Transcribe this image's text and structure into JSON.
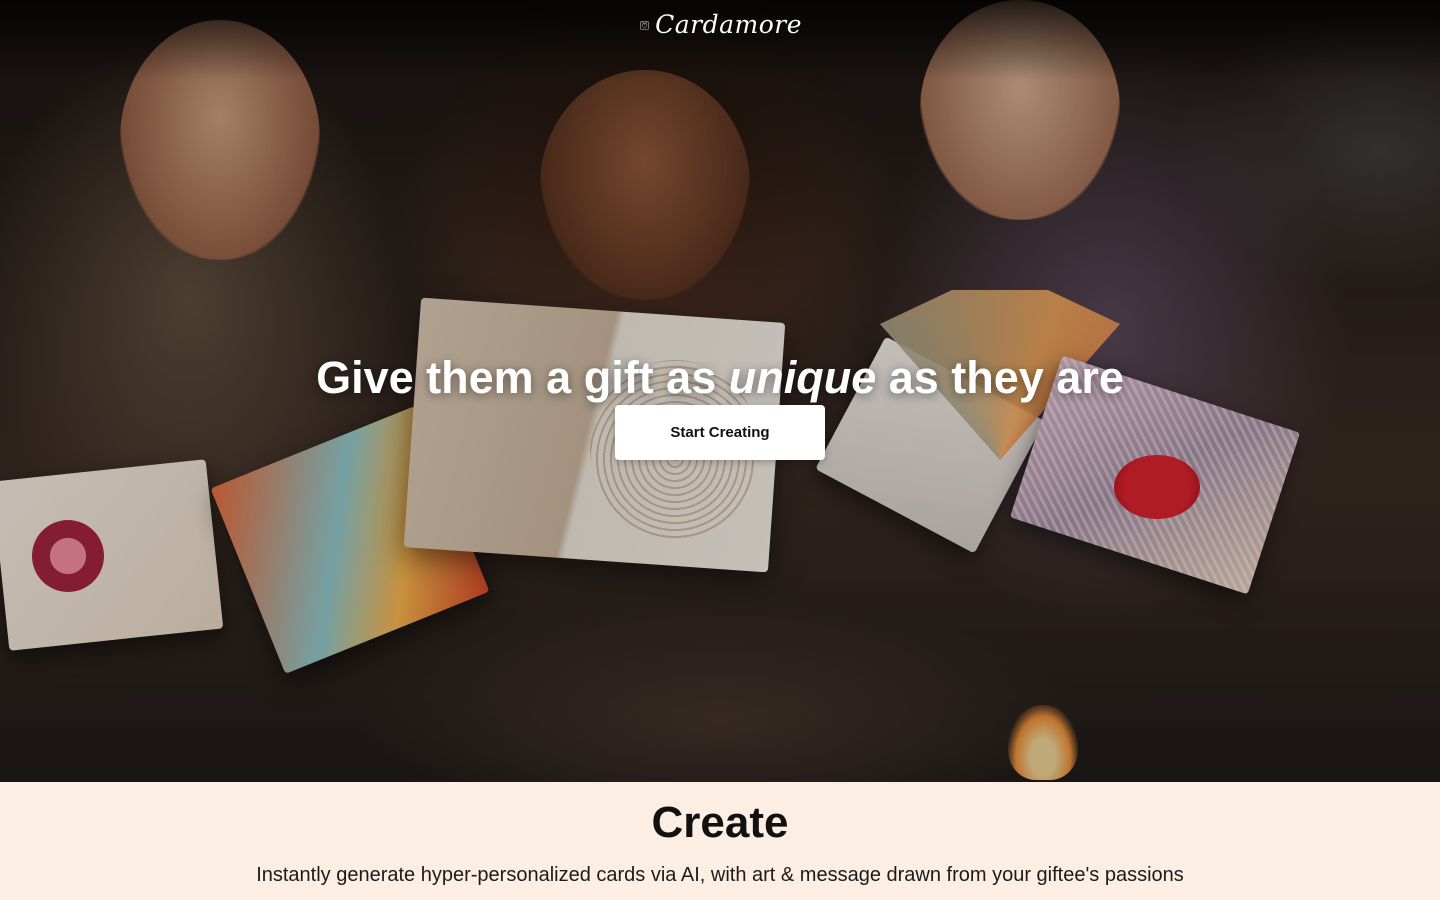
{
  "brand": {
    "name": "Cardamore",
    "logo_icon": "heart-card-icon"
  },
  "hero": {
    "image_alt": "friends-opening-greeting-cards-photo",
    "headline_before": "Give them a gift as ",
    "headline_emphasis": "unique",
    "headline_after": " as they are",
    "cta_label": "Start Creating"
  },
  "feature": {
    "title": "Create",
    "description": "Instantly generate hyper-personalized cards via AI, with art & message drawn from your giftee's passions"
  },
  "colors": {
    "feature_background": "#fdeee4",
    "cta_background": "#ffffff",
    "headline_text": "#ffffff",
    "body_text": "#111111"
  }
}
